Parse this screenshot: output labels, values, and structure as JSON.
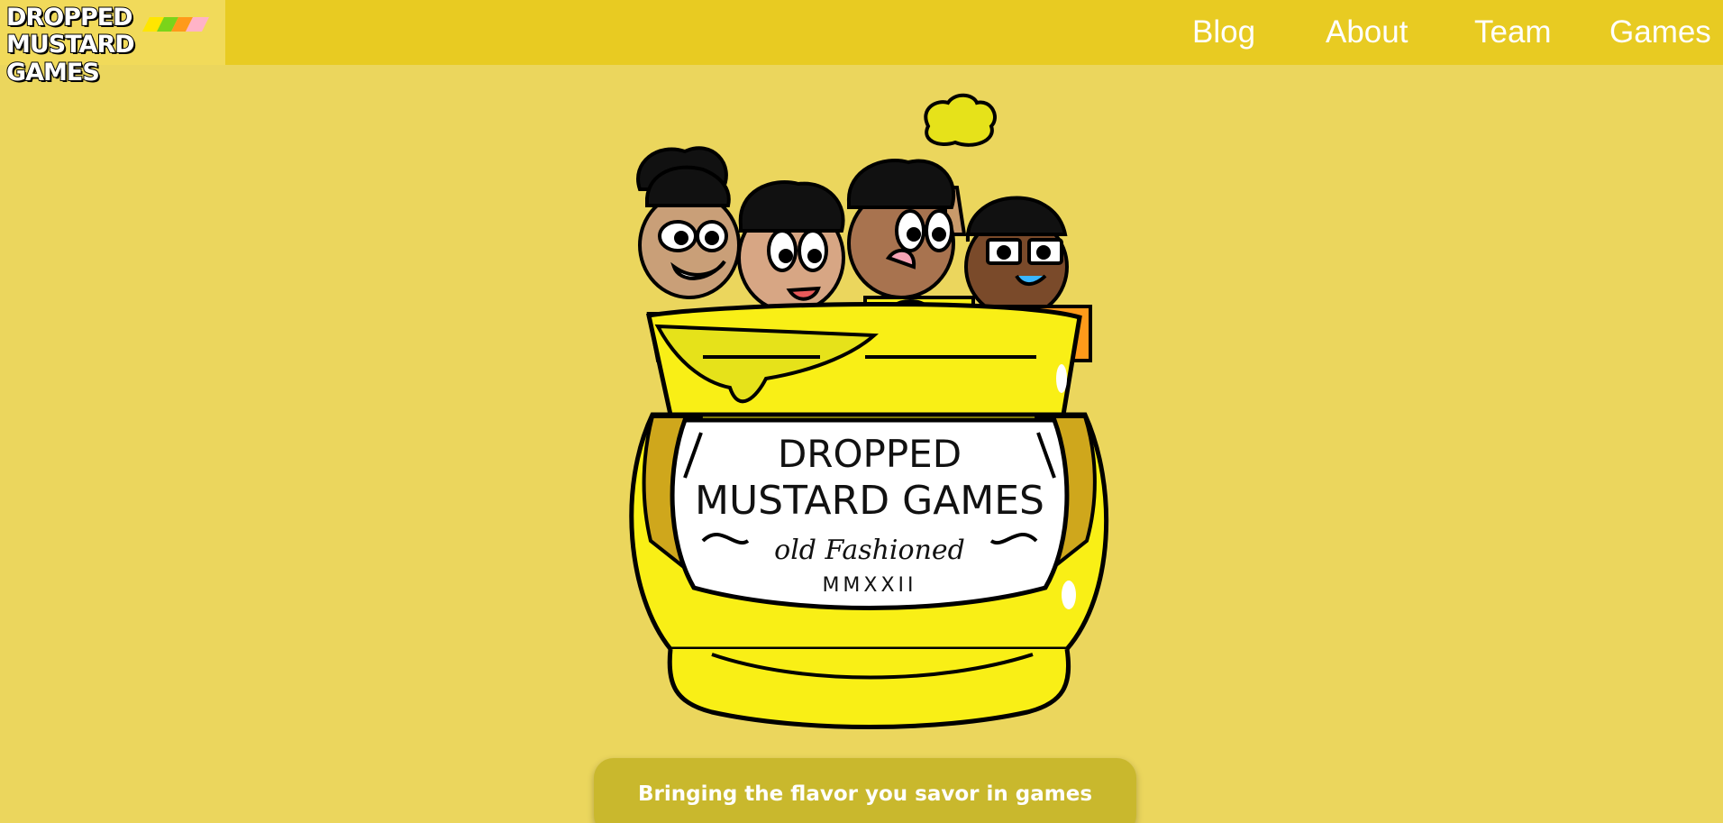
{
  "header": {
    "logo": {
      "line1": "DROPPED",
      "line2": "MUSTARD GAMES"
    },
    "nav": [
      {
        "label": "Blog"
      },
      {
        "label": "About"
      },
      {
        "label": "Team"
      },
      {
        "label": "Games"
      }
    ]
  },
  "hero": {
    "jar_label": {
      "line1": "DROPPED",
      "line2": "MUSTARD GAMES",
      "script": "old Fashioned",
      "year": "MMXXII"
    }
  },
  "tagline": "Bringing the flavor you savor in games",
  "colors": {
    "page_bg": "#ebd65d",
    "header_bg": "#e8cb22",
    "tagline_bg": "#c9b82d",
    "jar_yellow": "#f9ef16",
    "jar_band": "#cfa71c"
  }
}
